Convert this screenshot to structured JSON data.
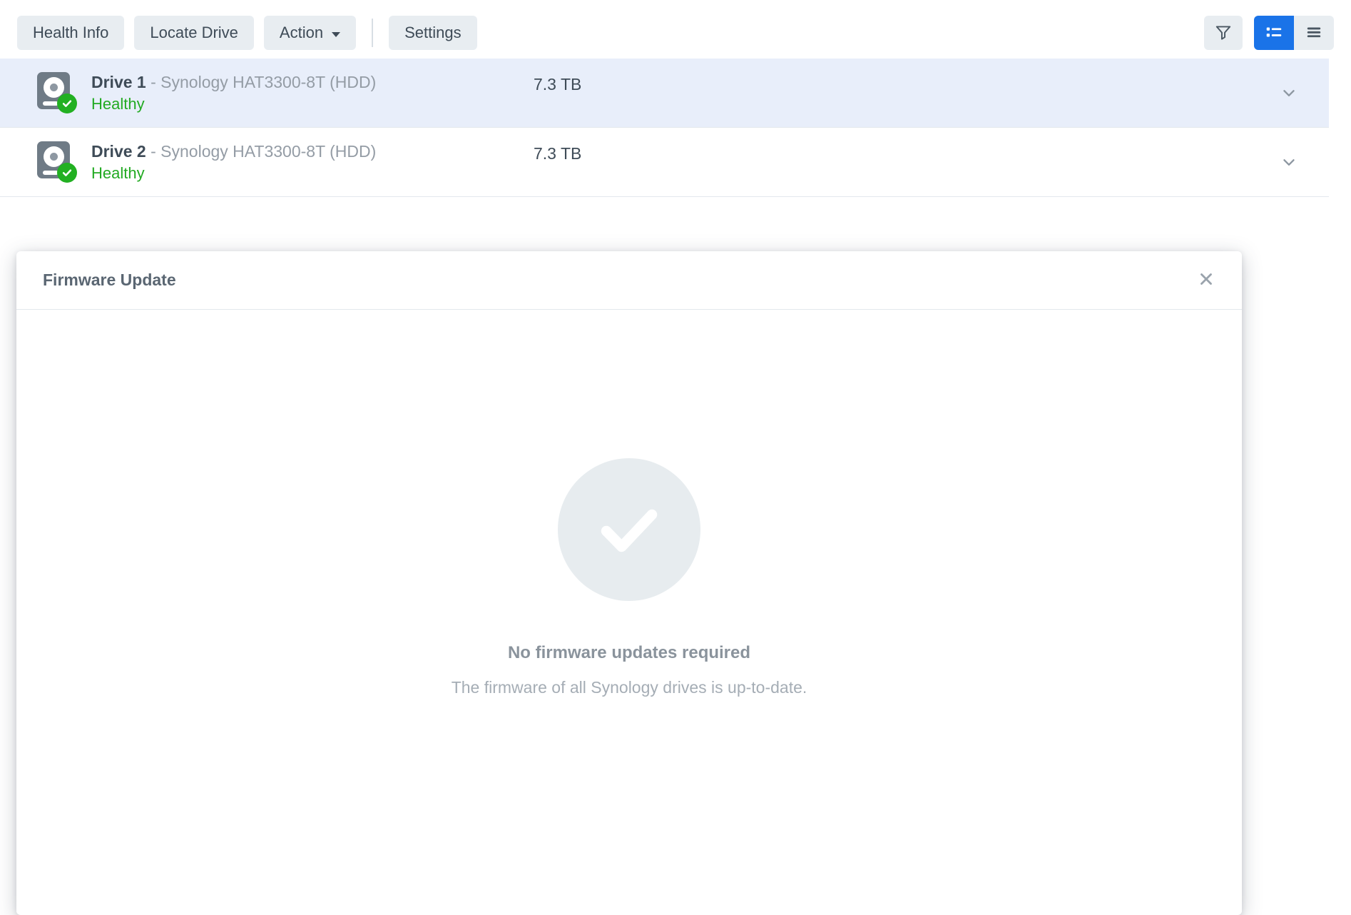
{
  "toolbar": {
    "buttons": [
      {
        "label": "Health Info",
        "name": "health-info-button",
        "has_caret": false
      },
      {
        "label": "Locate Drive",
        "name": "locate-drive-button",
        "has_caret": false
      },
      {
        "label": "Action",
        "name": "action-button",
        "has_caret": true
      }
    ],
    "settings_label": "Settings",
    "icons": {
      "filter": "filter-icon",
      "list_view": "list-view-icon",
      "menu_view": "hamburger-menu-icon"
    },
    "accent_color": "#1a73e8",
    "button_bg": "#e8edf1"
  },
  "drives": [
    {
      "name": "Drive 1",
      "separator": "-",
      "model": "Synology HAT3300-8T (HDD)",
      "capacity": "7.3 TB",
      "status": "Healthy",
      "status_color": "#22aa22",
      "selected": true
    },
    {
      "name": "Drive 2",
      "separator": "-",
      "model": "Synology HAT3300-8T (HDD)",
      "capacity": "7.3 TB",
      "status": "Healthy",
      "status_color": "#22aa22",
      "selected": false
    }
  ],
  "dialog": {
    "title": "Firmware Update",
    "close_label": "×",
    "empty_state": {
      "icon": "check-circle-icon",
      "icon_bg": "#e7ecef",
      "title": "No firmware updates required",
      "subtitle": "The firmware of all Synology drives is up-to-date."
    }
  }
}
